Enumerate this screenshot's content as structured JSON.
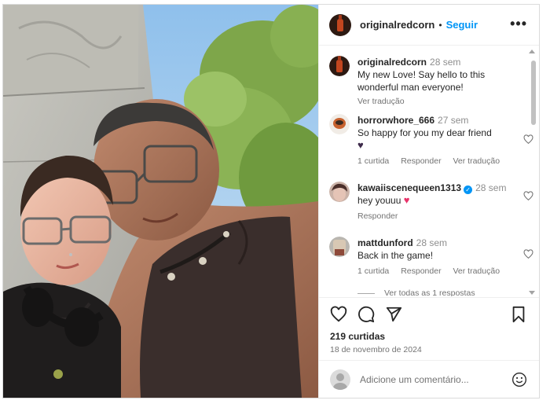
{
  "header": {
    "username": "originalredcorn",
    "separator": "•",
    "follow_label": "Seguir",
    "more_glyph": "•••"
  },
  "caption": {
    "username": "originalredcorn",
    "time": "28 sem",
    "text": "My new Love! Say hello to this wonderful man everyone!",
    "translate_label": "Ver tradução"
  },
  "comments": [
    {
      "username": "horrorwhore_666",
      "time": "27 sem",
      "text": "So happy for you my dear friend",
      "emoji": "♥",
      "likes_label": "1 curtida",
      "reply_label": "Responder",
      "translate_label": "Ver tradução"
    },
    {
      "username": "kawaiiscenequeen1313",
      "time": "28 sem",
      "text": "hey youuu",
      "emoji": "♥",
      "reply_label": "Responder"
    },
    {
      "username": "mattdunford",
      "time": "28 sem",
      "text": "Back in the game!",
      "likes_label": "1 curtida",
      "reply_label": "Responder",
      "translate_label": "Ver tradução"
    }
  ],
  "view_replies_label": "Ver todas as 1 respostas",
  "actions": {
    "icons": [
      "heart-icon",
      "comment-icon",
      "share-icon",
      "bookmark-icon"
    ],
    "likes": "219 curtidas",
    "date": "18 de novembro de 2024"
  },
  "add_comment": {
    "placeholder": "Adicione um comentário...",
    "emoji_icon": "smiley-icon"
  },
  "colors": {
    "accent": "#0095f6",
    "text": "#262626",
    "muted": "#737373",
    "dark_heart": "#3d2a4a",
    "pink_heart": "#e8336a"
  }
}
